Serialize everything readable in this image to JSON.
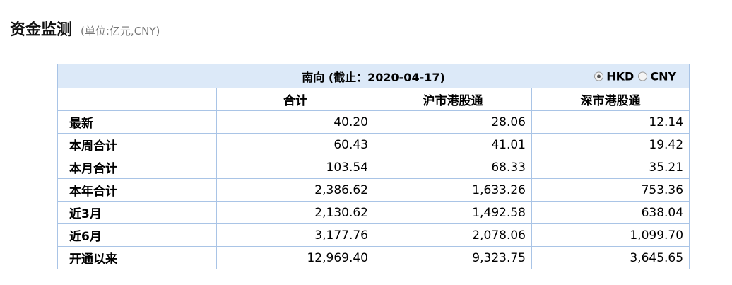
{
  "heading": {
    "title": "资金监测",
    "unit": "(单位:亿元,CNY)"
  },
  "table": {
    "caption": "南向 (截止：2020-04-17)",
    "currency_options": [
      {
        "label": "HKD",
        "selected": true
      },
      {
        "label": "CNY",
        "selected": false
      }
    ],
    "columns": [
      "",
      "合计",
      "沪市港股通",
      "深市港股通"
    ],
    "rows": [
      {
        "label": "最新",
        "total": "40.20",
        "sh": "28.06",
        "sz": "12.14"
      },
      {
        "label": "本周合计",
        "total": "60.43",
        "sh": "41.01",
        "sz": "19.42"
      },
      {
        "label": "本月合计",
        "total": "103.54",
        "sh": "68.33",
        "sz": "35.21"
      },
      {
        "label": "本年合计",
        "total": "2,386.62",
        "sh": "1,633.26",
        "sz": "753.36"
      },
      {
        "label": "近3月",
        "total": "2,130.62",
        "sh": "1,492.58",
        "sz": "638.04"
      },
      {
        "label": "近6月",
        "total": "3,177.76",
        "sh": "2,078.06",
        "sz": "1,099.70"
      },
      {
        "label": "开通以来",
        "total": "12,969.40",
        "sh": "9,323.75",
        "sz": "3,645.65"
      }
    ]
  },
  "colors": {
    "caption_bg": "#dce9f8",
    "border": "#a9c4e6"
  }
}
